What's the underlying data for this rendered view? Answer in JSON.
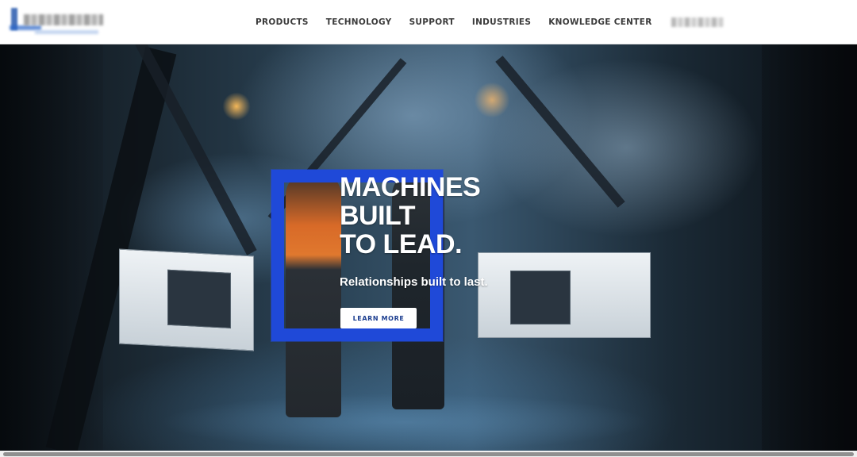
{
  "header": {
    "nav": [
      {
        "label": "PRODUCTS"
      },
      {
        "label": "TECHNOLOGY"
      },
      {
        "label": "SUPPORT"
      },
      {
        "label": "INDUSTRIES"
      },
      {
        "label": "KNOWLEDGE CENTER"
      }
    ]
  },
  "hero": {
    "title": "MACHINES\nBUILT\nTO LEAD.",
    "subtitle": "Relationships built to last.",
    "cta_label": "LEARN MORE"
  },
  "colors": {
    "accent_blue": "#1f49d8",
    "nav_text": "#3b3b3b",
    "cta_text": "#1b3d8f"
  }
}
